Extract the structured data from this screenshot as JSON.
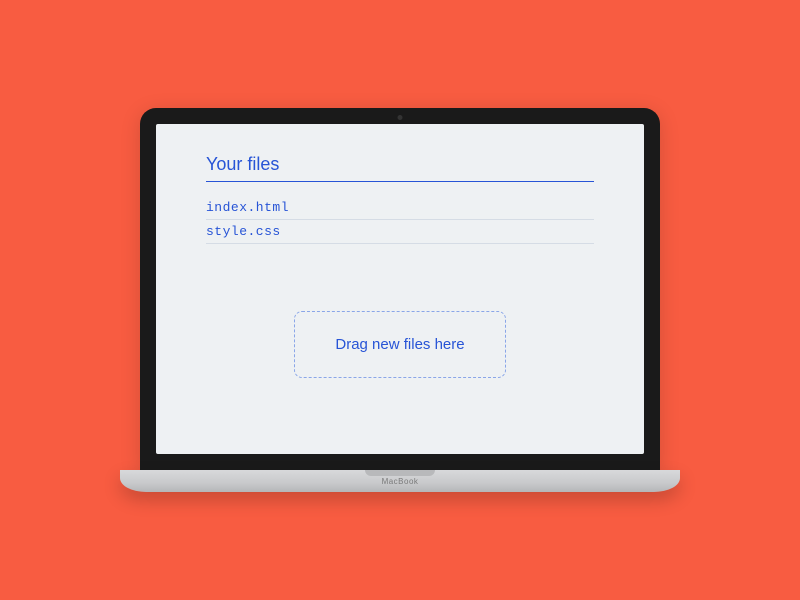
{
  "heading": "Your files",
  "files": [
    "index.html",
    "style.css"
  ],
  "dropzone_label": "Drag new files here",
  "device_brand": "MacBook"
}
